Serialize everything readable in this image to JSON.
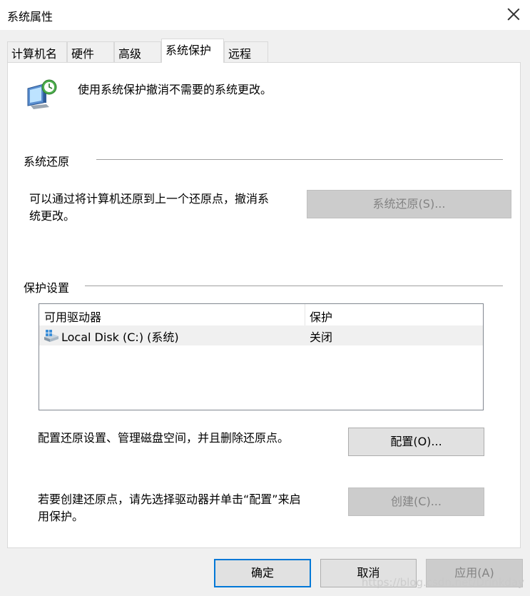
{
  "window": {
    "title": "系统属性",
    "close_icon": "close-icon"
  },
  "tabs": [
    {
      "label": "计算机名"
    },
    {
      "label": "硬件"
    },
    {
      "label": "高级"
    },
    {
      "label": "系统保护",
      "active": true
    },
    {
      "label": "远程"
    }
  ],
  "intro": {
    "text": "使用系统保护撤消不需要的系统更改。",
    "icon": "system-protection-icon"
  },
  "restore": {
    "heading": "系统还原",
    "description_line1": "可以通过将计算机还原到上一个还原点，撤消系",
    "description_line2": "统更改。",
    "button_label": "系统还原(S)..."
  },
  "protection": {
    "heading": "保护设置",
    "columns": [
      "可用驱动器",
      "保护"
    ],
    "drives": [
      {
        "name": "Local Disk (C:) (系统)",
        "protection": "关闭",
        "icon": "drive-icon"
      }
    ],
    "configure_text": "配置还原设置、管理磁盘空间，并且删除还原点。",
    "configure_button": "配置(O)...",
    "create_text_line1": "若要创建还原点，请先选择驱动器并单击“配置”来启",
    "create_text_line2": "用保护。",
    "create_button": "创建(C)..."
  },
  "footer": {
    "ok": "确定",
    "cancel": "取消",
    "apply": "应用(A)"
  },
  "watermark": "https://blog.csdn.net/Drinkday",
  "colors": {
    "accent": "#0078d7",
    "disabled_text": "#838383",
    "window_bg": "#f0f0f0"
  }
}
